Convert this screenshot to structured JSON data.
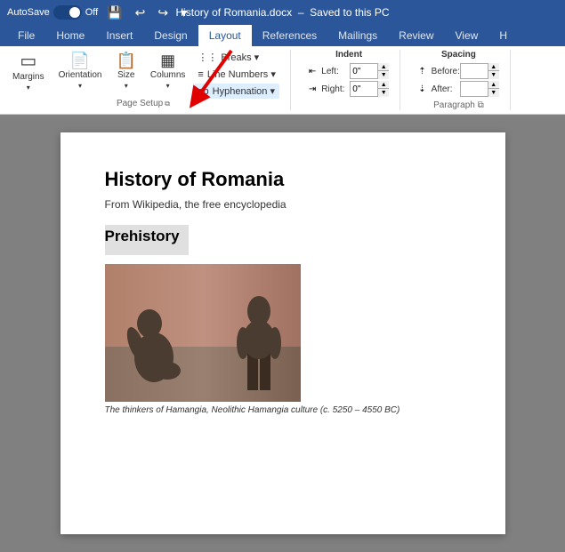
{
  "titlebar": {
    "autosave_label": "AutoSave",
    "autosave_state": "Off",
    "doc_title": "History of Romania.docx",
    "saved_label": "Saved to this PC"
  },
  "ribbon": {
    "tabs": [
      "File",
      "Home",
      "Insert",
      "Design",
      "Layout",
      "References",
      "Mailings",
      "Review",
      "View",
      "H"
    ],
    "active_tab": "Layout",
    "page_setup_group": {
      "label": "Page Setup",
      "buttons": [
        {
          "label": "Margins",
          "icon": "▭"
        },
        {
          "label": "Orientation",
          "icon": "📄"
        },
        {
          "label": "Size",
          "icon": "📋"
        },
        {
          "label": "Columns",
          "icon": "▦"
        }
      ],
      "dropdown_buttons": [
        {
          "label": "Breaks ▾"
        },
        {
          "label": "Line Numbers ▾"
        },
        {
          "label": "Hyphenation ▾"
        }
      ]
    },
    "indent_group": {
      "label": "Indent",
      "left_label": "Left:",
      "left_value": "0\"",
      "right_label": "Right:",
      "right_value": "0\""
    },
    "spacing_group": {
      "label": "Spacing",
      "before_label": "Before:",
      "before_value": "",
      "after_label": "After:",
      "after_value": ""
    },
    "paragraph_label": "Paragraph"
  },
  "document": {
    "title": "History of Romania",
    "subtitle": "From Wikipedia, the free encyclopedia",
    "section_heading": "Prehistory",
    "image_caption": "The thinkers of Hamangia, Neolithic Hamangia culture (c. 5250 – 4550 BC)"
  }
}
